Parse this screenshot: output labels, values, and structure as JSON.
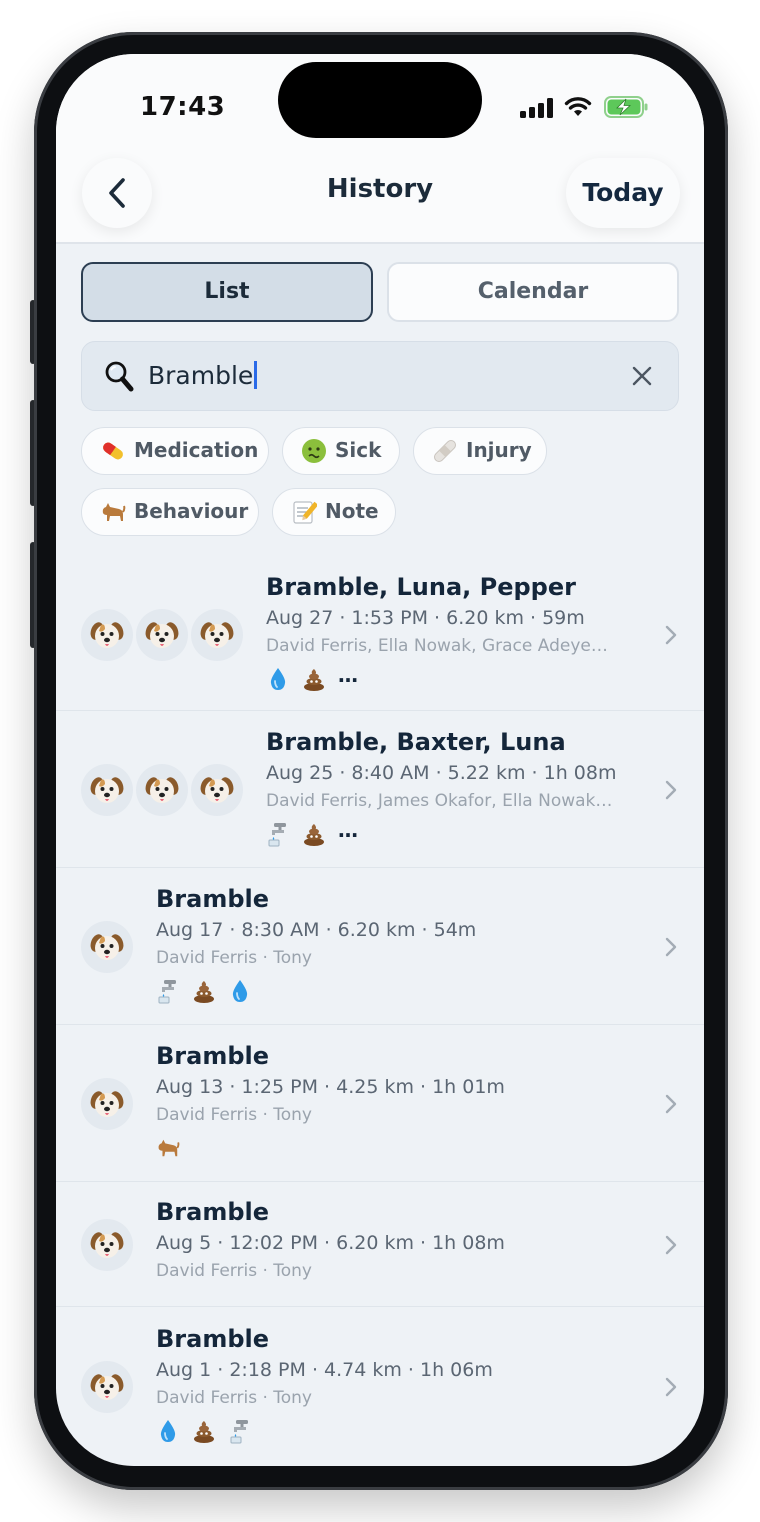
{
  "status_bar": {
    "time": "17:43"
  },
  "nav": {
    "title": "History",
    "today_label": "Today"
  },
  "tabs": [
    {
      "label": "List",
      "selected": true
    },
    {
      "label": "Calendar",
      "selected": false
    }
  ],
  "search": {
    "value": "Bramble"
  },
  "filters": [
    {
      "label": "Medication",
      "icon": "pill-icon"
    },
    {
      "label": "Sick",
      "icon": "sick-face-icon"
    },
    {
      "label": "Injury",
      "icon": "bandage-icon"
    },
    {
      "label": "Behaviour",
      "icon": "dog-icon"
    },
    {
      "label": "Note",
      "icon": "memo-icon"
    }
  ],
  "walks": [
    {
      "dogs": "Bramble, Luna, Pepper",
      "meta": "Aug 27 · 1:53 PM · 6.20 km · 59m",
      "people": "David Ferris, Ella Nowak, Grace Adeye…",
      "avatars": 3,
      "events": [
        "water-drop-icon",
        "poop-icon"
      ],
      "more": "…"
    },
    {
      "dogs": "Bramble, Baxter, Luna",
      "meta": "Aug 25 · 8:40 AM · 5.22 km · 1h 08m",
      "people": "David Ferris, James Okafor, Ella Nowak…",
      "avatars": 3,
      "events": [
        "water-tap-icon",
        "poop-icon"
      ],
      "more": "…"
    },
    {
      "dogs": "Bramble",
      "meta": "Aug 17 · 8:30 AM · 6.20 km · 54m",
      "people": "David Ferris · Tony",
      "avatars": 1,
      "events": [
        "water-tap-icon",
        "poop-icon",
        "water-drop-icon"
      ],
      "more": ""
    },
    {
      "dogs": "Bramble",
      "meta": "Aug 13 · 1:25 PM · 4.25 km · 1h 01m",
      "people": "David Ferris · Tony",
      "avatars": 1,
      "events": [
        "dog-icon"
      ],
      "more": ""
    },
    {
      "dogs": "Bramble",
      "meta": "Aug 5 · 12:02 PM · 6.20 km · 1h 08m",
      "people": "David Ferris · Tony",
      "avatars": 1,
      "events": [],
      "more": ""
    },
    {
      "dogs": "Bramble",
      "meta": "Aug 1 · 2:18 PM · 4.74 km · 1h 06m",
      "people": "David Ferris · Tony",
      "avatars": 1,
      "events": [
        "water-drop-icon",
        "poop-icon",
        "water-tap-icon"
      ],
      "more": ""
    }
  ]
}
